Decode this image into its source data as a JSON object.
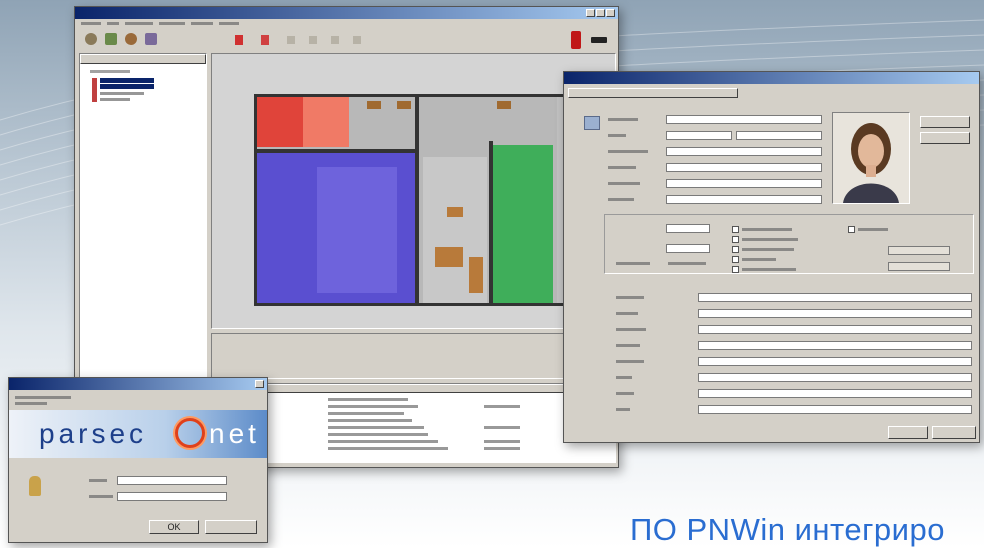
{
  "login_window": {
    "logo_part1": "parsec",
    "logo_part2": "net",
    "ok_button": "OK"
  },
  "caption": "ПО PNWin интегриро",
  "colors": {
    "title_bar": "#0a246a",
    "caption": "#2a6dd1",
    "room_red": "#e0443a",
    "room_blue": "#5a4fd0",
    "room_green": "#3fae5a",
    "room_orange": "#b87a3a"
  }
}
